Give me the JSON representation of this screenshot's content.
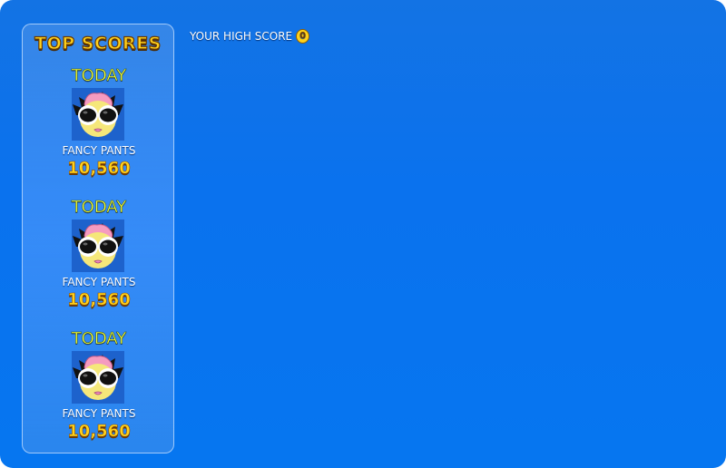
{
  "panel": {
    "title": "TOP SCORES",
    "entries": [
      {
        "label": "TODAY",
        "name": "FANCY PANTS",
        "score": "10,560"
      },
      {
        "label": "TODAY",
        "name": "FANCY PANTS",
        "score": "10,560"
      },
      {
        "label": "TODAY",
        "name": "FANCY PANTS",
        "score": "10,560"
      }
    ]
  },
  "high_score": {
    "label": "YOUR HIGH SCORE",
    "value": "0"
  },
  "colors": {
    "background": "#0a72ee",
    "title_yellow": "#ffd21a",
    "label_yellow": "#f8ff3a",
    "avatar_pink": "#f59bc0"
  },
  "icons": {
    "avatar": "penguin-avatar-icon",
    "coin": "coin-icon"
  }
}
